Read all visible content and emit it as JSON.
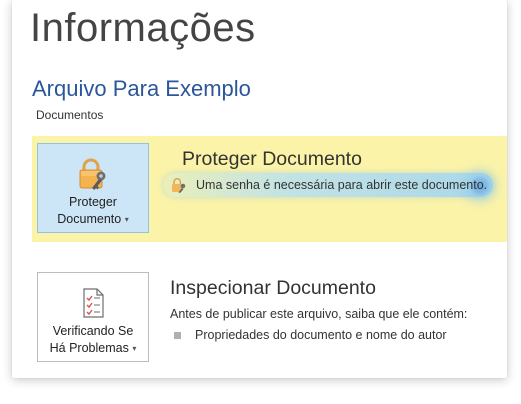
{
  "page": {
    "title": "Informações",
    "file_name": "Arquivo Para Exemplo",
    "location": "Documentos"
  },
  "protect": {
    "button_label_line1": "Proteger",
    "button_label_line2": "Documento",
    "heading": "Proteger Documento",
    "message": "Uma senha é necessária para abrir este documento.",
    "highlight_color": "#fbf3a8",
    "icons": {
      "button": "padlock-key-icon",
      "message": "small-padlock-key-icon"
    }
  },
  "inspect": {
    "button_label_line1": "Verificando Se",
    "button_label_line2": "Há Problemas",
    "heading": "Inspecionar Documento",
    "description": "Antes de publicar este arquivo, saiba que ele contém:",
    "items": [
      "Propriedades do documento e nome do autor"
    ],
    "icons": {
      "button": "document-checklist-icon"
    }
  },
  "dropdown_glyph": "▾"
}
